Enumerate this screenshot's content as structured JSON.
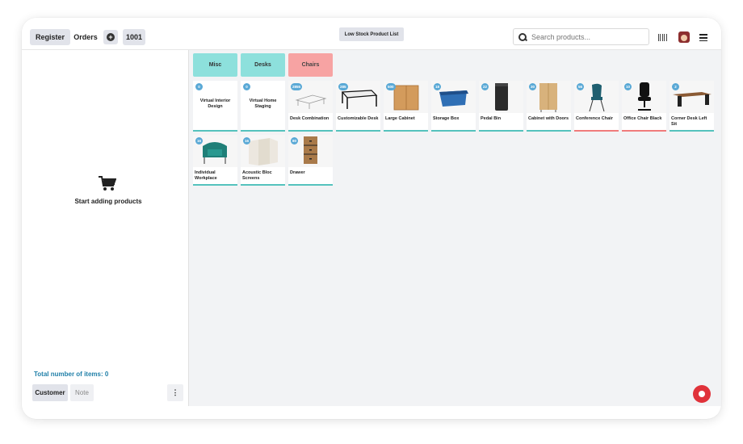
{
  "topbar": {
    "register": "Register",
    "orders": "Orders",
    "plus_icon": "plus-circle-icon",
    "order_number": "1001",
    "low_stock": "Low Stock Product List",
    "search_placeholder": "Search products...",
    "barcode_icon": "barcode-icon",
    "avatar_icon": "user-avatar",
    "menu_icon": "hamburger-menu-icon"
  },
  "left": {
    "empty_icon": "cart-icon",
    "empty_text": "Start adding products",
    "total_label": "Total number of items: 0",
    "customer": "Customer",
    "note": "Note",
    "more": "⋮"
  },
  "categories": [
    {
      "label": "Misc",
      "color": "#8de0dc"
    },
    {
      "label": "Desks",
      "color": "#8de0dc"
    },
    {
      "label": "Chairs",
      "color": "#f7a3a3"
    }
  ],
  "products": [
    {
      "name": "Virtual Interior Design",
      "qty": "0",
      "status": "ok"
    },
    {
      "name": "Virtual Home Staging",
      "qty": "0",
      "status": "ok"
    },
    {
      "name": "Desk Combination",
      "qty": "2855",
      "status": "ok"
    },
    {
      "name": "Customizable Desk",
      "qty": "285",
      "status": "ok"
    },
    {
      "name": "Large Cabinet",
      "qty": "500",
      "status": "ok"
    },
    {
      "name": "Storage Box",
      "qty": "18",
      "status": "ok"
    },
    {
      "name": "Pedal Bin",
      "qty": "22",
      "status": "ok"
    },
    {
      "name": "Cabinet with Doors",
      "qty": "30",
      "status": "ok"
    },
    {
      "name": "Conference Chair",
      "qty": "56",
      "status": "low"
    },
    {
      "name": "Office Chair Black",
      "qty": "10",
      "status": "low"
    },
    {
      "name": "Corner Desk Left Sit",
      "qty": "2",
      "status": "ok"
    },
    {
      "name": "Individual Workplace",
      "qty": "16",
      "status": "ok"
    },
    {
      "name": "Acoustic Bloc Screens",
      "qty": "16",
      "status": "ok"
    },
    {
      "name": "Drawer",
      "qty": "80",
      "status": "ok"
    }
  ],
  "fab_icon": "bug-icon",
  "colors": {
    "accent": "#55c2bd",
    "low": "#f07b7b",
    "badge": "#5aa9d6",
    "fab": "#e0323a"
  }
}
